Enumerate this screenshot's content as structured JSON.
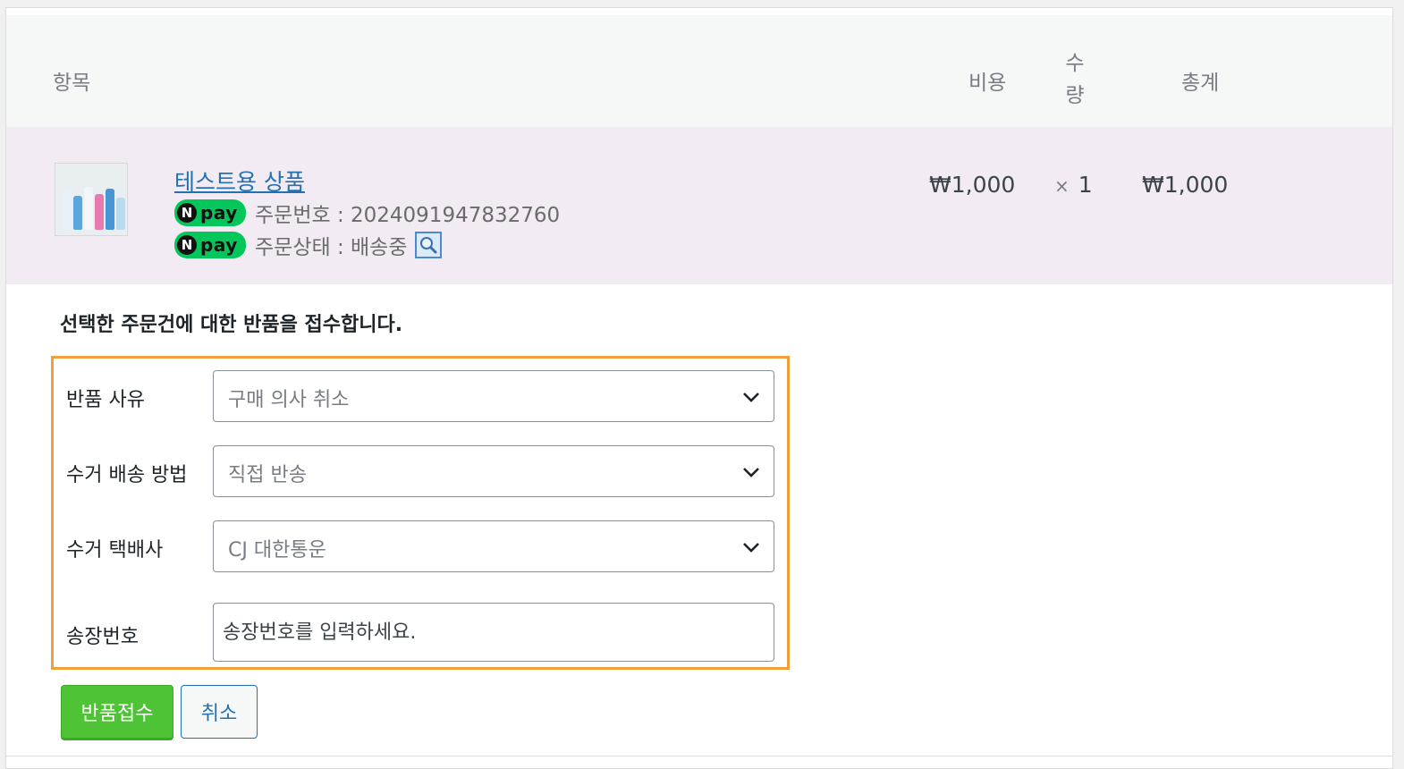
{
  "table": {
    "headers": {
      "item": "항목",
      "cost": "비용",
      "qty_line1": "수",
      "qty_line2": "량",
      "total": "총계"
    }
  },
  "order_item": {
    "product_name": "테스트용 상품",
    "npay_badge": "pay",
    "npay_n": "N",
    "order_number_text": "주문번호 : 2024091947832760",
    "order_status_text": "주문상태 : 배송중",
    "cost": "₩1,000",
    "qty_x": "×",
    "qty": "1",
    "total": "₩1,000"
  },
  "return_form": {
    "notice": "선택한 주문건에 대한 반품을 접수합니다.",
    "reason_label": "반품 사유",
    "reason_value": "구매 의사 취소",
    "method_label": "수거 배송 방법",
    "method_value": "직접 반송",
    "courier_label": "수거 택배사",
    "courier_value": "CJ 대한통운",
    "tracking_label": "송장번호",
    "tracking_placeholder": "송장번호를 입력하세요.",
    "submit_label": "반품접수",
    "cancel_label": "취소",
    "accent_color": "#f0a03a"
  },
  "colors": {
    "link": "#2271b1",
    "npay_green": "#03c75a",
    "submit_green": "#4fc336",
    "row_bg": "#f2ebf3"
  }
}
